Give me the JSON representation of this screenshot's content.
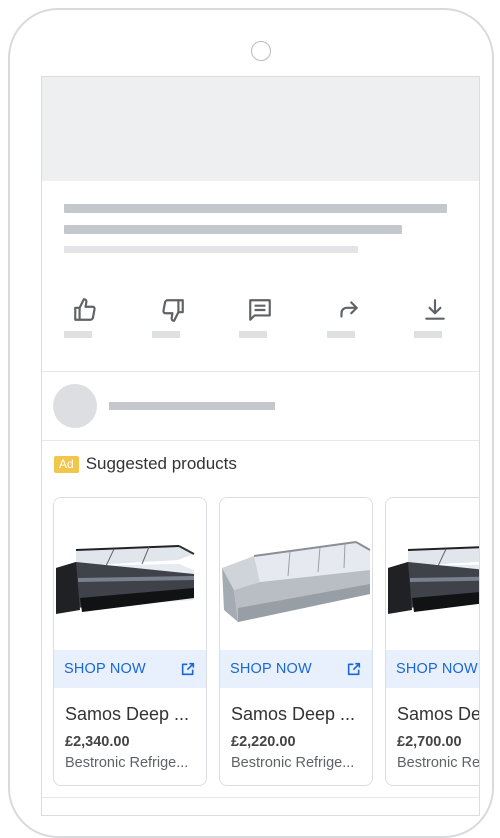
{
  "ad": {
    "badge": "Ad",
    "title": "Suggested products"
  },
  "actions": [
    {
      "icon": "thumbs-up-icon"
    },
    {
      "icon": "thumbs-down-icon"
    },
    {
      "icon": "comment-icon"
    },
    {
      "icon": "share-icon"
    },
    {
      "icon": "download-icon"
    }
  ],
  "products": [
    {
      "shop_label": "SHOP NOW",
      "name": "Samos Deep ...",
      "price": "£2,340.00",
      "seller": "Bestronic Refrige..."
    },
    {
      "shop_label": "SHOP NOW",
      "name": "Samos Deep ...",
      "price": "£2,220.00",
      "seller": "Bestronic Refrige..."
    },
    {
      "shop_label": "SHOP NOW",
      "name": "Samos De",
      "price": "£2,700.00",
      "seller": "Bestronic Re"
    }
  ],
  "colors": {
    "shop_accent": "#1967d2",
    "shop_bg": "#e8f0fd",
    "ad_badge": "#f1c64b",
    "skeleton": "#c4c7cb"
  }
}
